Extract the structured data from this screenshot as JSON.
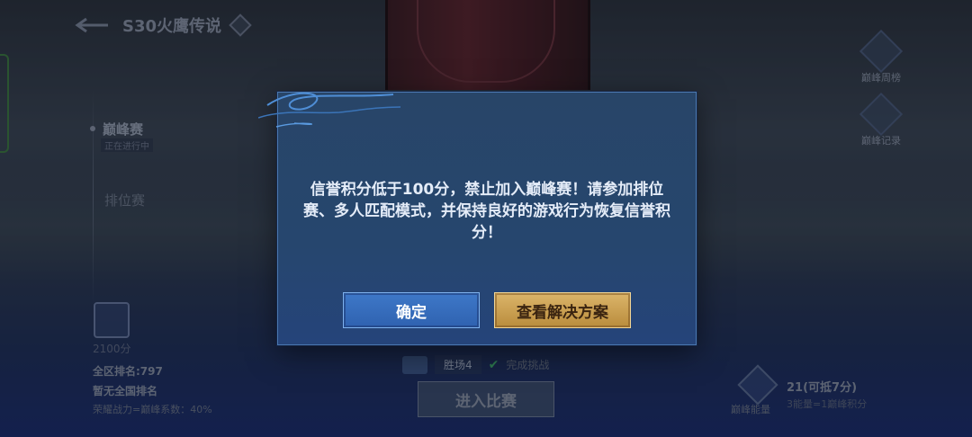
{
  "header": {
    "season_title": "S30火鹰传说"
  },
  "modes": {
    "active_label": "巅峰赛",
    "active_status": "正在进行中",
    "ranked_label": "排位赛"
  },
  "right_menu": {
    "weekly_label": "巅峰周榜",
    "record_label": "巅峰记录"
  },
  "profile": {
    "points": "2100分",
    "region_rank": "全区排名:797",
    "national_rank": "暂无全国排名",
    "honor_note": "荣耀战力=巅峰系数：40%"
  },
  "match": {
    "win_label": "胜场4",
    "challenge_label": "完成挑战",
    "enter_label": "进入比赛"
  },
  "energy": {
    "label": "巅峰能量",
    "value": "21(可抵7分)",
    "note": "3能量=1巅峰积分"
  },
  "dialog": {
    "message": "信誉积分低于100分，禁止加入巅峰赛！请参加排位赛、多人匹配模式，并保持良好的游戏行为恢复信誉积分！",
    "confirm_label": "确定",
    "solution_label": "查看解决方案"
  },
  "colors": {
    "dialog_bg": "#26466e",
    "confirm_bg": "#3e78c8",
    "solution_bg": "#dcb56a"
  }
}
